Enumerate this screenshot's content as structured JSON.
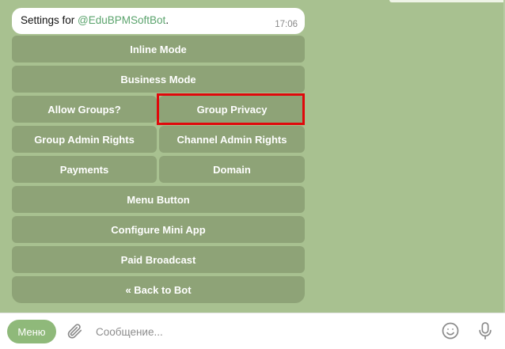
{
  "message": {
    "prefix": "Settings for ",
    "mention": "@EduBPMSoftBot",
    "suffix": ".",
    "time": "17:06"
  },
  "keyboard": {
    "inline_mode": "Inline Mode",
    "business_mode": "Business Mode",
    "allow_groups": "Allow Groups?",
    "group_privacy": "Group Privacy",
    "group_admin_rights": "Group Admin Rights",
    "channel_admin_rights": "Channel Admin Rights",
    "payments": "Payments",
    "domain": "Domain",
    "menu_button": "Menu Button",
    "configure_mini_app": "Configure Mini App",
    "paid_broadcast": "Paid Broadcast",
    "back_to_bot": "« Back to Bot"
  },
  "composer": {
    "menu_label": "Меню",
    "placeholder": "Сообщение..."
  },
  "icons": {
    "attach": "paperclip-icon",
    "emoji": "smile-icon",
    "mic": "microphone-icon"
  },
  "colors": {
    "chat_background": "#a8c190",
    "button_background": "#8ea377",
    "highlight": "#e0080b",
    "mention": "#5aa36c",
    "menu_button": "#8fb97a"
  }
}
